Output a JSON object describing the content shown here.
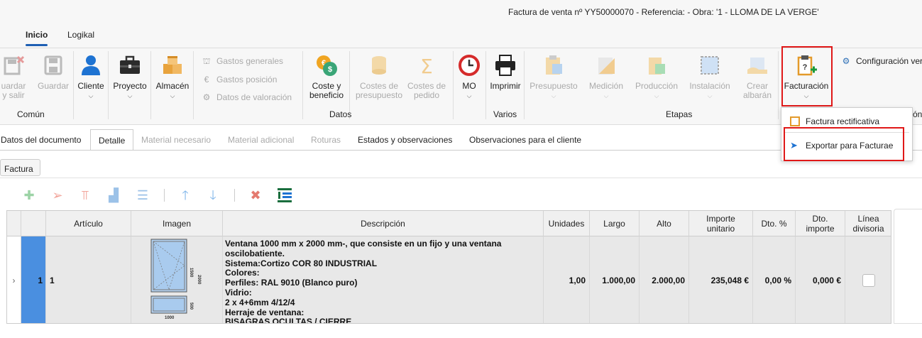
{
  "window": {
    "title": "Factura de venta nº YY50000070 - Referencia:  - Obra: '1 - LLOMA DE LA VERGE'"
  },
  "menu_tabs": [
    {
      "label": "Inicio",
      "active": true
    },
    {
      "label": "Logikal",
      "active": false
    }
  ],
  "ribbon": {
    "comun": {
      "guardar_y_salir": "uardar\ny salir",
      "guardar": "Guardar",
      "group": "Común"
    },
    "cliente": "Cliente",
    "proyecto": "Proyecto",
    "almacen": "Almacén",
    "gastos_generales": "Gastos generales",
    "gastos_posicion": "Gastos posición",
    "datos_valoracion": "Datos de valoración",
    "coste_beneficio": "Coste y\nbeneficio",
    "costes_presupuesto": "Costes de\npresupuesto",
    "costes_pedido": "Costes de\npedido",
    "mo": "MO",
    "datos_group": "Datos",
    "imprimir": "Imprimir",
    "varios_group": "Varios",
    "presupuesto": "Presupuesto",
    "medicion": "Medición",
    "produccion": "Producción",
    "instalacion": "Instalación",
    "crear_albaran": "Crear\nalbarán",
    "etapas_group": "Etapas",
    "facturacion": "Facturación",
    "configuracion": "Configuración ver",
    "cut_group": "ón"
  },
  "dropdown": {
    "items": [
      "Factura rectificativa",
      "Exportar para Facturae"
    ]
  },
  "doc_tabs": [
    {
      "label": "Datos del documento",
      "state": "normal"
    },
    {
      "label": "Detalle",
      "state": "active"
    },
    {
      "label": "Material necesario",
      "state": "disabled"
    },
    {
      "label": "Material adicional",
      "state": "disabled"
    },
    {
      "label": "Roturas",
      "state": "disabled"
    },
    {
      "label": "Estados y observaciones",
      "state": "normal"
    },
    {
      "label": "Observaciones para el cliente",
      "state": "normal"
    }
  ],
  "sub_tab": "Factura",
  "table": {
    "columns": [
      "Artículo",
      "Imagen",
      "Descripción",
      "Unidades",
      "Largo",
      "Alto",
      "Importe\nunitario",
      "Dto. %",
      "Dto.\nimporte",
      "Línea\ndivisoria"
    ],
    "rows": [
      {
        "index": "1",
        "articulo": "1",
        "descripcion": [
          "Ventana 1000 mm x 2000 mm-, que consiste en un fijo y una ventana",
          "oscilobatiente.",
          "Sistema:Cortizo COR 80 INDUSTRIAL",
          "Colores:",
          "Perfiles: RAL 9010 (Blanco puro)",
          "Vidrio:",
          "2 x 4+6mm 4/12/4",
          "Herraje de ventana:",
          "BISAGRAS OCULTAS / CIERRE"
        ],
        "unidades": "1,00",
        "largo": "1.000,00",
        "alto": "2.000,00",
        "importe_unitario": "235,048 €",
        "dto_pct": "0,00 %",
        "dto_importe": "0,000 €",
        "window_labels": {
          "w": "1000",
          "h1": "1500",
          "h2": "500",
          "total": "2000"
        }
      }
    ]
  }
}
